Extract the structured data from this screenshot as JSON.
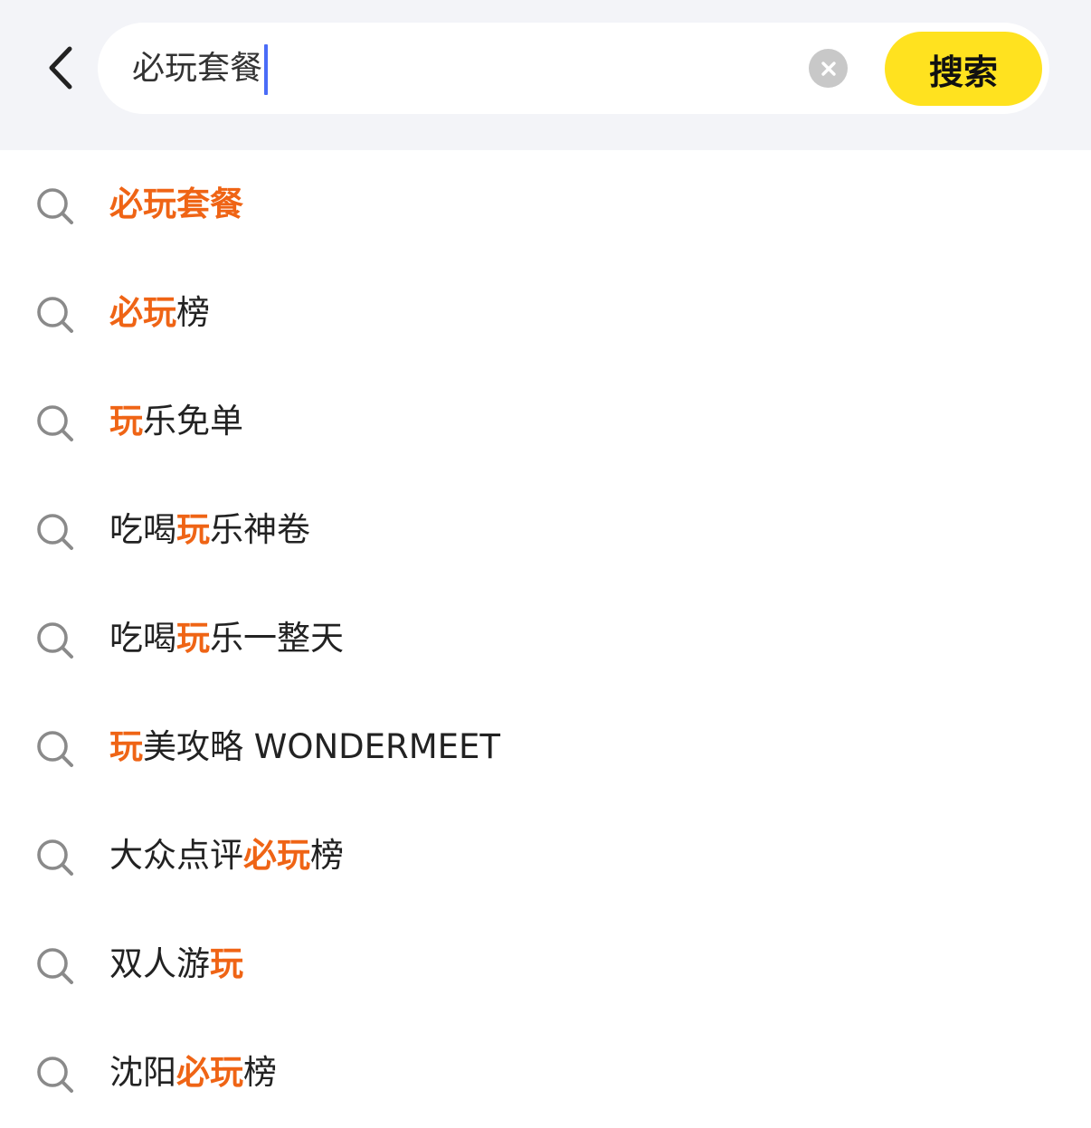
{
  "search": {
    "value": "必玩套餐",
    "submit_label": "搜索",
    "accent_color": "#ffe21f",
    "highlight_color": "#ef6415"
  },
  "icons": {
    "back": "chevron-left-icon",
    "clear": "clear-circle-icon",
    "suggestion": "search-icon"
  },
  "suggestions": [
    {
      "parts": [
        {
          "t": "必玩套餐",
          "hl": true
        }
      ]
    },
    {
      "parts": [
        {
          "t": "必玩",
          "hl": true
        },
        {
          "t": "榜",
          "hl": false
        }
      ]
    },
    {
      "parts": [
        {
          "t": "玩",
          "hl": true
        },
        {
          "t": "乐免单",
          "hl": false
        }
      ]
    },
    {
      "parts": [
        {
          "t": "吃喝",
          "hl": false
        },
        {
          "t": "玩",
          "hl": true
        },
        {
          "t": "乐神卷",
          "hl": false
        }
      ]
    },
    {
      "parts": [
        {
          "t": "吃喝",
          "hl": false
        },
        {
          "t": "玩",
          "hl": true
        },
        {
          "t": "乐一整天",
          "hl": false
        }
      ]
    },
    {
      "parts": [
        {
          "t": "玩",
          "hl": true
        },
        {
          "t": "美攻略 WONDERMEET",
          "hl": false
        }
      ]
    },
    {
      "parts": [
        {
          "t": "大众点评",
          "hl": false
        },
        {
          "t": "必玩",
          "hl": true
        },
        {
          "t": "榜",
          "hl": false
        }
      ]
    },
    {
      "parts": [
        {
          "t": "双人游",
          "hl": false
        },
        {
          "t": "玩",
          "hl": true
        }
      ]
    },
    {
      "parts": [
        {
          "t": "沈阳",
          "hl": false
        },
        {
          "t": "必玩",
          "hl": true
        },
        {
          "t": "榜",
          "hl": false
        }
      ]
    }
  ]
}
